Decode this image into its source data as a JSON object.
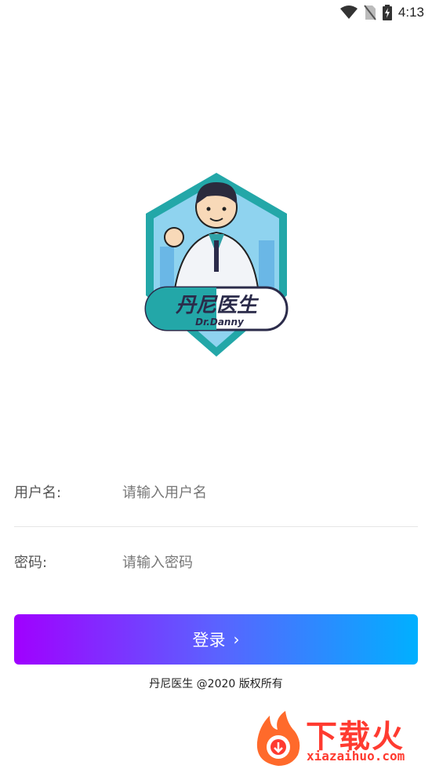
{
  "status_bar": {
    "time": "4:13"
  },
  "logo": {
    "title": "丹尼医生",
    "subtitle": "Dr.Danny"
  },
  "form": {
    "username_label": "用户名:",
    "username_placeholder": "请输入用户名",
    "password_label": "密码:",
    "password_placeholder": "请输入密码"
  },
  "login_button": {
    "label": "登录",
    "chevron": "›"
  },
  "footer": {
    "copyright": "丹尼医生 @2020 版权所有"
  },
  "watermark": {
    "cn": "下载火",
    "en": "xiazaihuo.com"
  },
  "colors": {
    "button_gradient_start": "#a000ff",
    "button_gradient_end": "#00b0ff",
    "shield_teal": "#23a7a8",
    "watermark_red": "#ff3b30"
  },
  "icons": [
    "wifi-icon",
    "no-sim-icon",
    "battery-charging-icon",
    "chevron-right-icon",
    "doctor-logo-icon",
    "fire-logo-icon"
  ]
}
